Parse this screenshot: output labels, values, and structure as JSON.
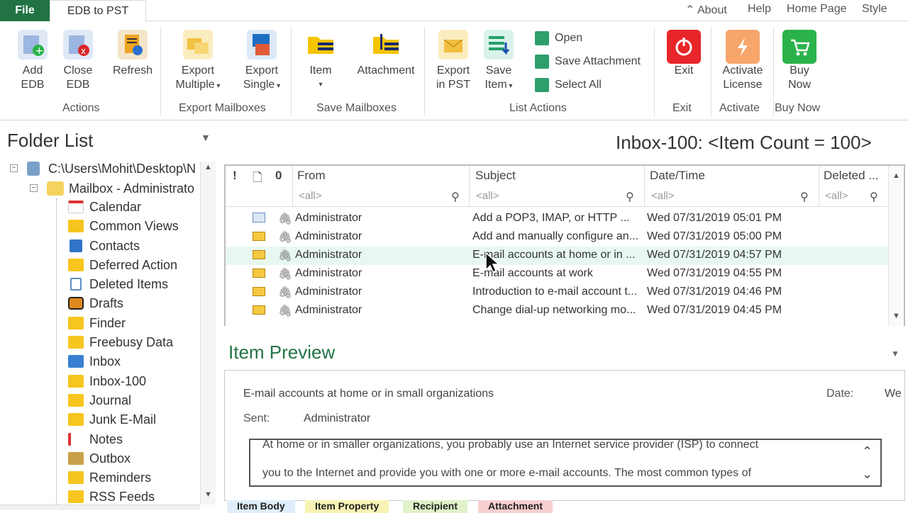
{
  "menu": {
    "file": "File",
    "tab": "EDB to PST",
    "links": [
      "About",
      "Help",
      "Home Page",
      "Style"
    ]
  },
  "ribbon": {
    "actions": {
      "add": [
        "Add",
        "EDB"
      ],
      "close": [
        "Close",
        "EDB"
      ],
      "refresh": "Refresh",
      "group": "Actions"
    },
    "export": {
      "multiple": [
        "Export",
        "Multiple"
      ],
      "single": [
        "Export",
        "Single"
      ],
      "group": "Export Mailboxes"
    },
    "save": {
      "item": "Item",
      "attachment": "Attachment",
      "group": "Save Mailboxes"
    },
    "list": {
      "export_pst": [
        "Export",
        "in PST"
      ],
      "save_item": [
        "Save",
        "Item"
      ],
      "open": "Open",
      "save_attachment": "Save Attachment",
      "select_all": "Select All",
      "group": "List Actions"
    },
    "exit": {
      "label": "Exit",
      "group": "Exit"
    },
    "activate": {
      "label": [
        "Activate",
        "License"
      ],
      "group": "Activate"
    },
    "buy": {
      "label": [
        "Buy",
        "Now"
      ],
      "group": "Buy Now"
    }
  },
  "folders": {
    "title": "Folder List",
    "root": "C:\\Users\\Mohit\\Desktop\\N",
    "mailbox": "Mailbox - Administrato",
    "items": [
      "Calendar",
      "Common Views",
      "Contacts",
      "Deferred Action",
      "Deleted Items",
      "Drafts",
      "Finder",
      "Freebusy Data",
      "Inbox",
      "Inbox-100",
      "Journal",
      "Junk E-Mail",
      "Notes",
      "Outbox",
      "Reminders",
      "RSS Feeds"
    ]
  },
  "grid": {
    "title": "Inbox-100: <Item Count = 100>",
    "headers": {
      "importance": "!",
      "type": "🗋",
      "attach": "0",
      "from": "From",
      "subject": "Subject",
      "date": "Date/Time",
      "deleted": "Deleted ..."
    },
    "filter": "<all>",
    "rows": [
      {
        "from": "Administrator",
        "subject": "Add a POP3, IMAP, or HTTP ...",
        "date": "Wed 07/31/2019 05:01 PM"
      },
      {
        "from": "Administrator",
        "subject": "Add and manually configure an...",
        "date": "Wed 07/31/2019 05:00 PM"
      },
      {
        "from": "Administrator",
        "subject": "E-mail accounts at home or in ...",
        "date": "Wed 07/31/2019 04:57 PM"
      },
      {
        "from": "Administrator",
        "subject": "E-mail accounts at work",
        "date": "Wed 07/31/2019 04:55 PM"
      },
      {
        "from": "Administrator",
        "subject": "Introduction to e-mail account t...",
        "date": "Wed 07/31/2019 04:46 PM"
      },
      {
        "from": "Administrator",
        "subject": "Change dial-up networking mo...",
        "date": "Wed 07/31/2019 04:45 PM"
      }
    ]
  },
  "preview": {
    "title": "Item Preview",
    "subject": "E-mail accounts at home or in small organizations",
    "date_label": "Date:",
    "date_value": "We",
    "sent_label": "Sent:",
    "sent_value": "Administrator",
    "body_line1": "At home or in smaller organizations, you probably use an Internet service provider (ISP) to connect",
    "body_line2": "you to the Internet and provide you with one or more e-mail accounts. The most common types of",
    "tabs": [
      "Item Body",
      "Item Property",
      "Recipient",
      "Attachment"
    ]
  },
  "colors": {
    "accent": "#217346",
    "selected_row": "#e8f8f0"
  }
}
